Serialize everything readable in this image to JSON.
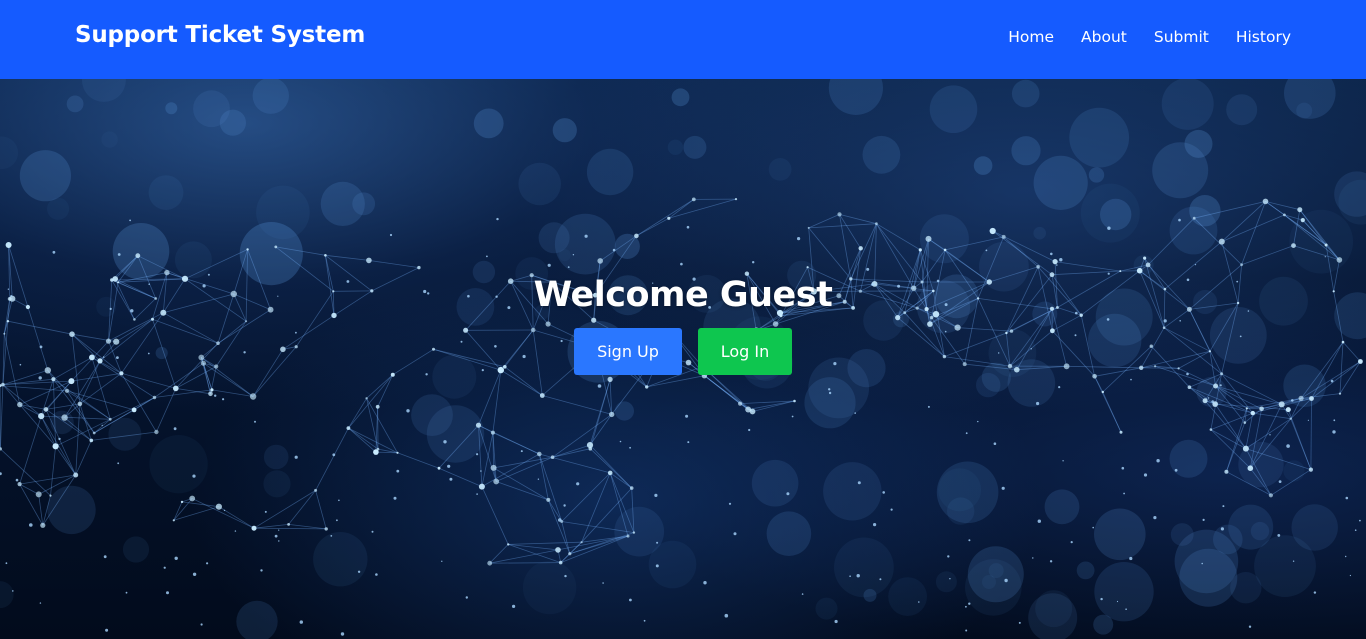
{
  "navbar": {
    "brand": "Support Ticket System",
    "links": [
      "Home",
      "About",
      "Submit",
      "History"
    ]
  },
  "hero": {
    "title": "Welcome Guest",
    "signup_label": "Sign Up",
    "login_label": "Log In"
  },
  "colors": {
    "navbar_bg": "#155bff",
    "signup_bg": "#2a77ff",
    "login_bg": "#0ec64f",
    "text": "#ffffff"
  }
}
